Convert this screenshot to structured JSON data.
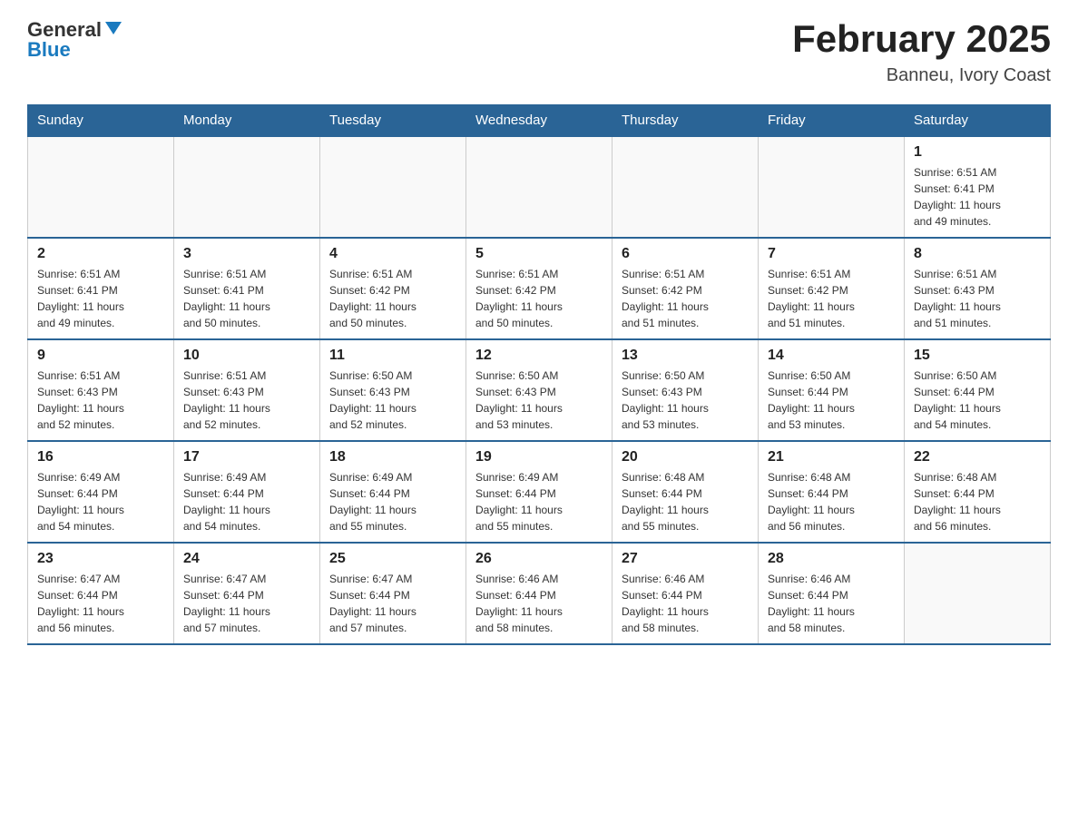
{
  "header": {
    "logo": {
      "general": "General",
      "blue": "Blue"
    },
    "title": "February 2025",
    "location": "Banneu, Ivory Coast"
  },
  "calendar": {
    "days_of_week": [
      "Sunday",
      "Monday",
      "Tuesday",
      "Wednesday",
      "Thursday",
      "Friday",
      "Saturday"
    ],
    "weeks": [
      [
        {
          "day": "",
          "info": ""
        },
        {
          "day": "",
          "info": ""
        },
        {
          "day": "",
          "info": ""
        },
        {
          "day": "",
          "info": ""
        },
        {
          "day": "",
          "info": ""
        },
        {
          "day": "",
          "info": ""
        },
        {
          "day": "1",
          "info": "Sunrise: 6:51 AM\nSunset: 6:41 PM\nDaylight: 11 hours\nand 49 minutes."
        }
      ],
      [
        {
          "day": "2",
          "info": "Sunrise: 6:51 AM\nSunset: 6:41 PM\nDaylight: 11 hours\nand 49 minutes."
        },
        {
          "day": "3",
          "info": "Sunrise: 6:51 AM\nSunset: 6:41 PM\nDaylight: 11 hours\nand 50 minutes."
        },
        {
          "day": "4",
          "info": "Sunrise: 6:51 AM\nSunset: 6:42 PM\nDaylight: 11 hours\nand 50 minutes."
        },
        {
          "day": "5",
          "info": "Sunrise: 6:51 AM\nSunset: 6:42 PM\nDaylight: 11 hours\nand 50 minutes."
        },
        {
          "day": "6",
          "info": "Sunrise: 6:51 AM\nSunset: 6:42 PM\nDaylight: 11 hours\nand 51 minutes."
        },
        {
          "day": "7",
          "info": "Sunrise: 6:51 AM\nSunset: 6:42 PM\nDaylight: 11 hours\nand 51 minutes."
        },
        {
          "day": "8",
          "info": "Sunrise: 6:51 AM\nSunset: 6:43 PM\nDaylight: 11 hours\nand 51 minutes."
        }
      ],
      [
        {
          "day": "9",
          "info": "Sunrise: 6:51 AM\nSunset: 6:43 PM\nDaylight: 11 hours\nand 52 minutes."
        },
        {
          "day": "10",
          "info": "Sunrise: 6:51 AM\nSunset: 6:43 PM\nDaylight: 11 hours\nand 52 minutes."
        },
        {
          "day": "11",
          "info": "Sunrise: 6:50 AM\nSunset: 6:43 PM\nDaylight: 11 hours\nand 52 minutes."
        },
        {
          "day": "12",
          "info": "Sunrise: 6:50 AM\nSunset: 6:43 PM\nDaylight: 11 hours\nand 53 minutes."
        },
        {
          "day": "13",
          "info": "Sunrise: 6:50 AM\nSunset: 6:43 PM\nDaylight: 11 hours\nand 53 minutes."
        },
        {
          "day": "14",
          "info": "Sunrise: 6:50 AM\nSunset: 6:44 PM\nDaylight: 11 hours\nand 53 minutes."
        },
        {
          "day": "15",
          "info": "Sunrise: 6:50 AM\nSunset: 6:44 PM\nDaylight: 11 hours\nand 54 minutes."
        }
      ],
      [
        {
          "day": "16",
          "info": "Sunrise: 6:49 AM\nSunset: 6:44 PM\nDaylight: 11 hours\nand 54 minutes."
        },
        {
          "day": "17",
          "info": "Sunrise: 6:49 AM\nSunset: 6:44 PM\nDaylight: 11 hours\nand 54 minutes."
        },
        {
          "day": "18",
          "info": "Sunrise: 6:49 AM\nSunset: 6:44 PM\nDaylight: 11 hours\nand 55 minutes."
        },
        {
          "day": "19",
          "info": "Sunrise: 6:49 AM\nSunset: 6:44 PM\nDaylight: 11 hours\nand 55 minutes."
        },
        {
          "day": "20",
          "info": "Sunrise: 6:48 AM\nSunset: 6:44 PM\nDaylight: 11 hours\nand 55 minutes."
        },
        {
          "day": "21",
          "info": "Sunrise: 6:48 AM\nSunset: 6:44 PM\nDaylight: 11 hours\nand 56 minutes."
        },
        {
          "day": "22",
          "info": "Sunrise: 6:48 AM\nSunset: 6:44 PM\nDaylight: 11 hours\nand 56 minutes."
        }
      ],
      [
        {
          "day": "23",
          "info": "Sunrise: 6:47 AM\nSunset: 6:44 PM\nDaylight: 11 hours\nand 56 minutes."
        },
        {
          "day": "24",
          "info": "Sunrise: 6:47 AM\nSunset: 6:44 PM\nDaylight: 11 hours\nand 57 minutes."
        },
        {
          "day": "25",
          "info": "Sunrise: 6:47 AM\nSunset: 6:44 PM\nDaylight: 11 hours\nand 57 minutes."
        },
        {
          "day": "26",
          "info": "Sunrise: 6:46 AM\nSunset: 6:44 PM\nDaylight: 11 hours\nand 58 minutes."
        },
        {
          "day": "27",
          "info": "Sunrise: 6:46 AM\nSunset: 6:44 PM\nDaylight: 11 hours\nand 58 minutes."
        },
        {
          "day": "28",
          "info": "Sunrise: 6:46 AM\nSunset: 6:44 PM\nDaylight: 11 hours\nand 58 minutes."
        },
        {
          "day": "",
          "info": ""
        }
      ]
    ]
  }
}
